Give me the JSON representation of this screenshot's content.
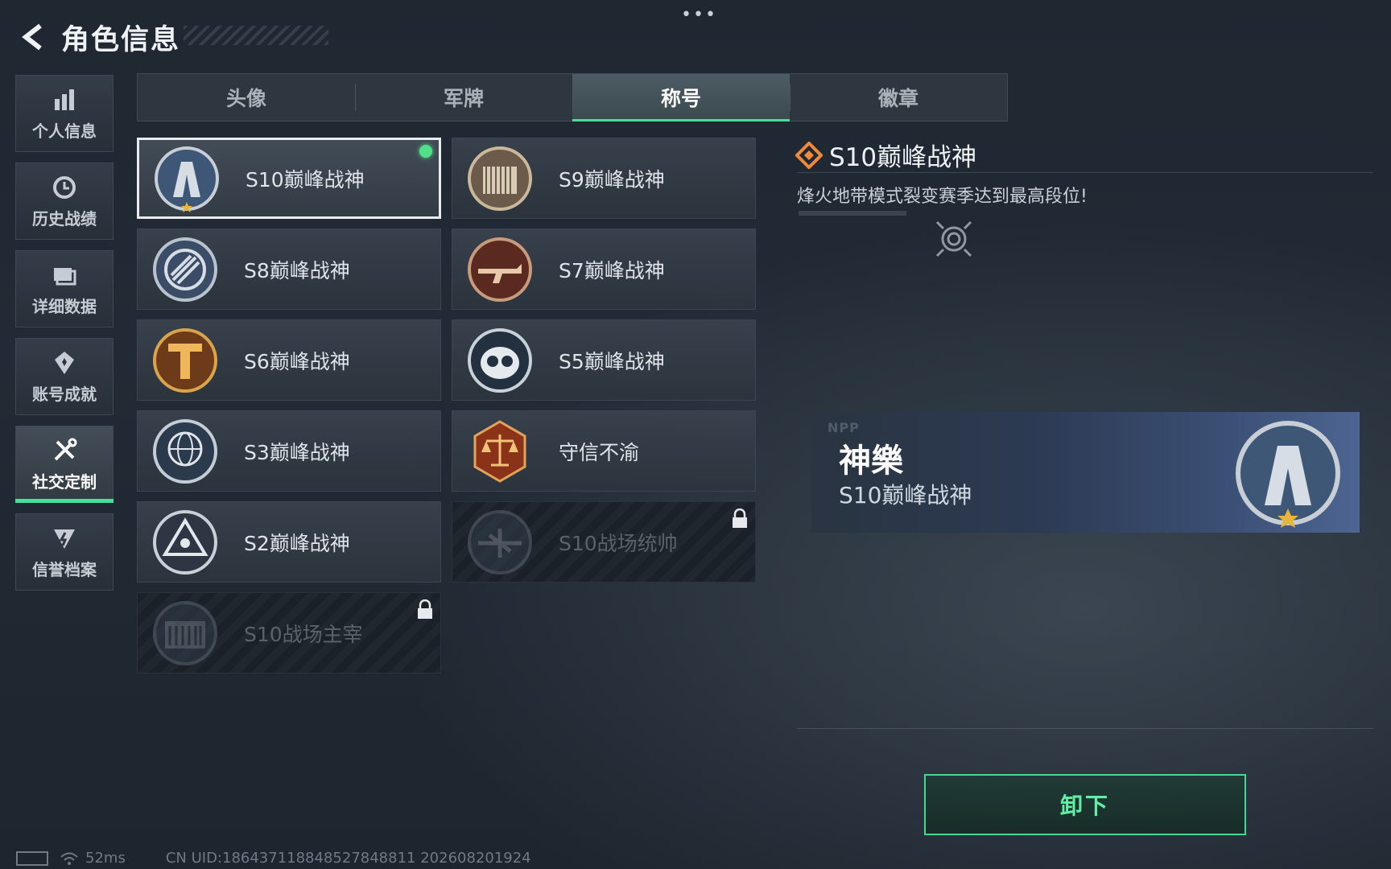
{
  "header": {
    "title": "角色信息"
  },
  "top_menu": {
    "dots": "•••"
  },
  "sidebar": {
    "items": [
      {
        "label": "个人信息",
        "icon": "bar-chart-icon",
        "active": false
      },
      {
        "label": "历史战绩",
        "icon": "history-clock-icon",
        "active": false
      },
      {
        "label": "详细数据",
        "icon": "folder-data-icon",
        "active": false
      },
      {
        "label": "账号成就",
        "icon": "achievement-badge-icon",
        "active": false
      },
      {
        "label": "社交定制",
        "icon": "tools-icon",
        "active": true
      },
      {
        "label": "信誉档案",
        "icon": "shield-credit-icon",
        "active": false
      }
    ]
  },
  "tabs": [
    {
      "label": "头像",
      "active": false
    },
    {
      "label": "军牌",
      "active": false
    },
    {
      "label": "称号",
      "active": true
    },
    {
      "label": "徽章",
      "active": false
    }
  ],
  "titles": [
    {
      "label": "S10巅峰战神",
      "emblem": "s10-tower-emblem-icon",
      "state": "equipped"
    },
    {
      "label": "S9巅峰战神",
      "emblem": "s9-building-emblem-icon",
      "state": "owned"
    },
    {
      "label": "S8巅峰战神",
      "emblem": "s8-stripes-emblem-icon",
      "state": "owned"
    },
    {
      "label": "S7巅峰战神",
      "emblem": "s7-rifle-emblem-icon",
      "state": "owned"
    },
    {
      "label": "S6巅峰战神",
      "emblem": "s6-letter-t-emblem-icon",
      "state": "owned"
    },
    {
      "label": "S5巅峰战神",
      "emblem": "s5-skull-mask-emblem-icon",
      "state": "owned"
    },
    {
      "label": "S3巅峰战神",
      "emblem": "s3-globe-emblem-icon",
      "state": "owned"
    },
    {
      "label": "守信不渝",
      "emblem": "scales-justice-emblem-icon",
      "state": "owned"
    },
    {
      "label": "S2巅峰战神",
      "emblem": "s2-triangle-emblem-icon",
      "state": "owned"
    },
    {
      "label": "S10战场统帅",
      "emblem": "aircraft-emblem-icon",
      "state": "locked"
    },
    {
      "label": "S10战场主宰",
      "emblem": "colosseum-emblem-icon",
      "state": "locked"
    }
  ],
  "detail": {
    "title": "S10巅峰战神",
    "description": "烽火地带模式裂变赛季达到最高段位!"
  },
  "preview": {
    "watermark": "NPP",
    "player_name": "神樂",
    "title": "S10巅峰战神"
  },
  "actions": {
    "unequip_label": "卸下"
  },
  "status_bar": {
    "ping": "52ms",
    "uid": "CN UID:18643711884852784881‌1 202608201924"
  },
  "colors": {
    "accent": "#45e09a",
    "equipped": "#52e08b"
  }
}
